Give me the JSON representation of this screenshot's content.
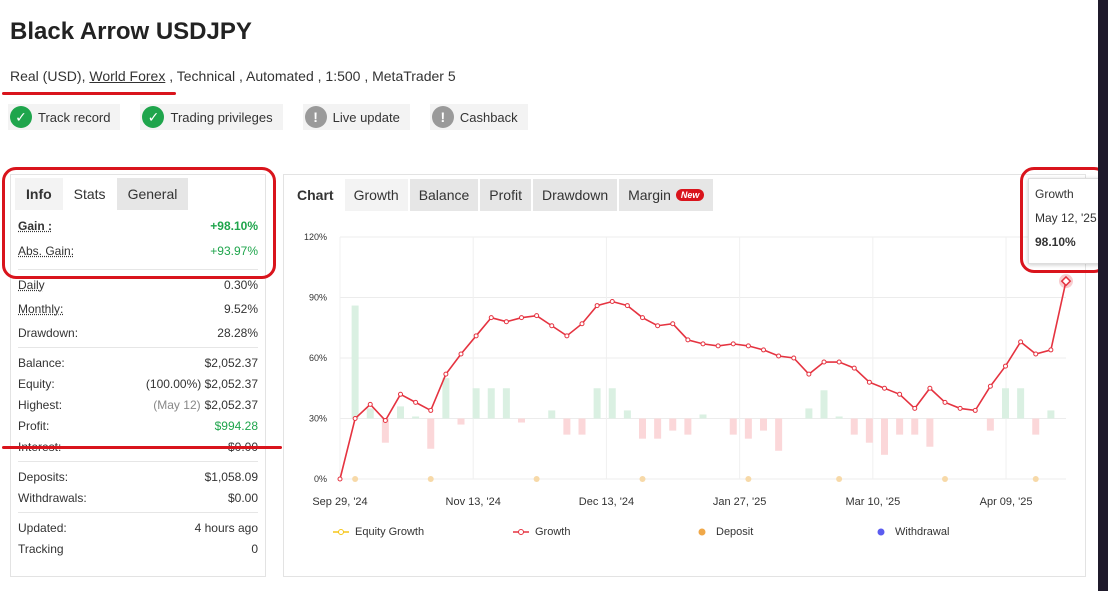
{
  "header": {
    "title": "Black Arrow USDJPY",
    "sub_account": "Real (USD),",
    "sub_broker": "World Forex",
    "sub_rest": ", Technical , Automated , 1:500 , MetaTrader 5"
  },
  "badges": [
    {
      "label": "Track record",
      "status": "verified",
      "icon": "check-icon"
    },
    {
      "label": "Trading privileges",
      "status": "verified",
      "icon": "check-icon"
    },
    {
      "label": "Live update",
      "status": "unverified",
      "icon": "exclamation-icon"
    },
    {
      "label": "Cashback",
      "status": "unverified",
      "icon": "exclamation-icon"
    }
  ],
  "stats_panel": {
    "tabs": [
      "Info",
      "Stats",
      "General"
    ],
    "gain_label": "Gain :",
    "gain_value": "+98.10%",
    "abs_gain_label": "Abs. Gain:",
    "abs_gain_value": "+93.97%",
    "daily_label": "Daily",
    "daily_value": "0.30%",
    "monthly_label": "Monthly:",
    "monthly_value": "9.52%",
    "drawdown_label": "Drawdown:",
    "drawdown_value": "28.28%",
    "balance_label": "Balance:",
    "balance_value": "$2,052.37",
    "equity_label": "Equity:",
    "equity_value": "(100.00%) $2,052.37",
    "highest_label": "Highest:",
    "highest_note": "(May 12)",
    "highest_value": "$2,052.37",
    "profit_label": "Profit:",
    "profit_value": "$994.28",
    "interest_label": "Interest:",
    "interest_value": "$0.00",
    "deposits_label": "Deposits:",
    "deposits_value": "$1,058.09",
    "withdrawals_label": "Withdrawals:",
    "withdrawals_value": "$0.00",
    "updated_label": "Updated:",
    "updated_value": "4 hours ago",
    "tracking_label": "Tracking",
    "tracking_value": "0"
  },
  "chart_tabs": {
    "chart": "Chart",
    "growth": "Growth",
    "balance": "Balance",
    "profit": "Profit",
    "drawdown": "Drawdown",
    "margin": "Margin",
    "new_tag": "New"
  },
  "tooltip": {
    "series": "Growth",
    "date": "May 12, '25",
    "value": "98.10%"
  },
  "legend": {
    "equity": "Equity Growth",
    "growth": "Growth",
    "deposit": "Deposit",
    "withdrawal": "Withdrawal"
  },
  "colors": {
    "growth_line": "#e53340",
    "positive_bar": "#daf0e2",
    "negative_bar": "#fbd7d9",
    "deposit": "#f0a848",
    "withdrawal": "#5b5cf0",
    "equity": "#f5c518"
  },
  "chart_data": {
    "type": "line",
    "ylim": [
      0,
      120
    ],
    "yticks": [
      "0%",
      "30%",
      "60%",
      "90%",
      "120%"
    ],
    "xticks": [
      "Sep 29, '24",
      "Nov 13, '24",
      "Dec 13, '24",
      "Jan 27, '25",
      "Mar 10, '25",
      "Apr 09, '25"
    ],
    "growth": [
      0,
      30,
      37,
      29,
      42,
      38,
      34,
      52,
      62,
      71,
      80,
      78,
      80,
      81,
      76,
      71,
      77,
      86,
      88,
      86,
      80,
      76,
      77,
      69,
      67,
      66,
      67,
      66,
      64,
      61,
      60,
      52,
      58,
      58,
      55,
      48,
      45,
      42,
      35,
      45,
      38,
      35,
      34,
      46,
      56,
      68,
      62,
      64,
      98.1
    ],
    "bars": [
      0,
      56,
      5,
      -12,
      6,
      1,
      -15,
      20,
      -3,
      15,
      15,
      15,
      -2,
      0,
      4,
      -8,
      -8,
      15,
      15,
      4,
      -10,
      -10,
      -6,
      -8,
      2,
      0,
      -8,
      -10,
      -6,
      -16,
      0,
      5,
      14,
      1,
      -8,
      -12,
      -18,
      -8,
      -8,
      -14,
      0,
      0,
      0,
      -6,
      15,
      15,
      -8,
      4,
      0
    ],
    "deposit_markers": [
      1,
      6,
      13,
      20,
      27,
      33,
      40,
      46
    ]
  }
}
